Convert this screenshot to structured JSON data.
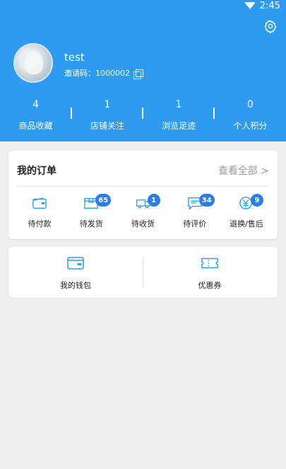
{
  "status_bar": {
    "time": "2:45"
  },
  "profile": {
    "username": "test",
    "invite_label": "邀请码：",
    "invite_code": "1000002"
  },
  "stats": [
    {
      "value": "4",
      "label": "商品收藏"
    },
    {
      "value": "1",
      "label": "店铺关注"
    },
    {
      "value": "1",
      "label": "浏览足迹"
    },
    {
      "value": "0",
      "label": "个人积分"
    }
  ],
  "orders": {
    "title": "我的订单",
    "view_all": "查看全部 >",
    "items": [
      {
        "label": "待付款",
        "badge": null,
        "icon": "wallet-icon"
      },
      {
        "label": "待发货",
        "badge": "65",
        "icon": "package-icon"
      },
      {
        "label": "待收货",
        "badge": "1",
        "icon": "truck-icon"
      },
      {
        "label": "待评价",
        "badge": "34",
        "icon": "comment-icon"
      },
      {
        "label": "退换/售后",
        "badge": "9",
        "icon": "refund-icon"
      }
    ]
  },
  "services": [
    {
      "label": "我的钱包",
      "icon": "wallet-icon"
    },
    {
      "label": "优惠券",
      "icon": "coupon-icon"
    }
  ],
  "colors": {
    "primary": "#2d9bf0",
    "badge": "#2d7ee3",
    "icon": "#2d9bf0",
    "page_background": "#efefef"
  }
}
